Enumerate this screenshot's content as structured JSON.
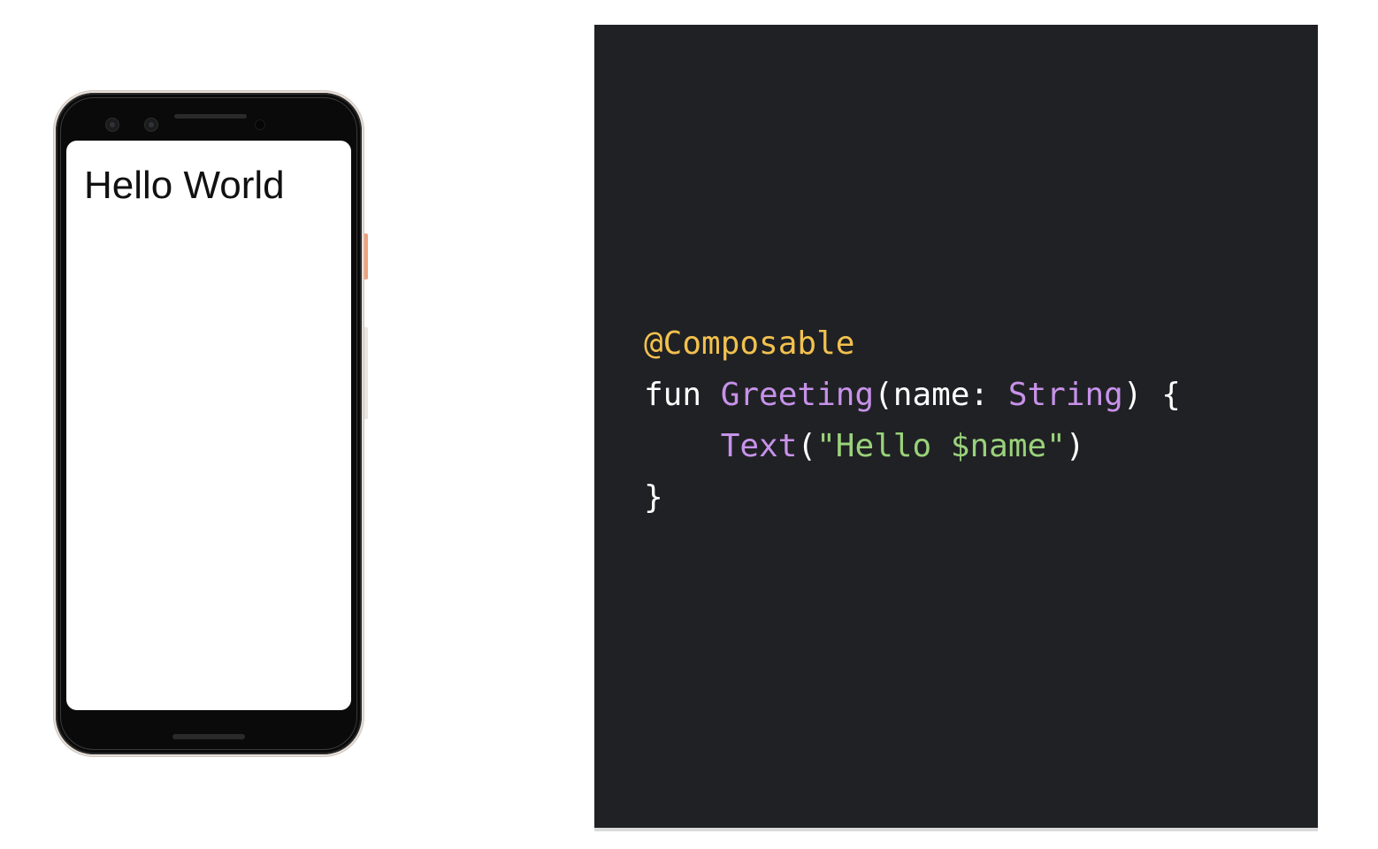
{
  "phone": {
    "screen_text": "Hello World"
  },
  "code": {
    "colors": {
      "annotation": "#f2c14e",
      "plain": "#ffffff",
      "function_name": "#c792ea",
      "type": "#c792ea",
      "string": "#9ad27b",
      "background": "#202124"
    },
    "lines": [
      [
        {
          "text": "@Composable",
          "kind": "annotation"
        }
      ],
      [
        {
          "text": "fun ",
          "kind": "plain"
        },
        {
          "text": "Greeting",
          "kind": "function_name"
        },
        {
          "text": "(name: ",
          "kind": "plain"
        },
        {
          "text": "String",
          "kind": "type"
        },
        {
          "text": ") {",
          "kind": "plain"
        }
      ],
      [
        {
          "text": "    ",
          "kind": "plain"
        },
        {
          "text": "Text",
          "kind": "function_name"
        },
        {
          "text": "(",
          "kind": "plain"
        },
        {
          "text": "\"Hello $name\"",
          "kind": "string"
        },
        {
          "text": ")",
          "kind": "plain"
        }
      ],
      [
        {
          "text": "}",
          "kind": "plain"
        }
      ]
    ]
  }
}
